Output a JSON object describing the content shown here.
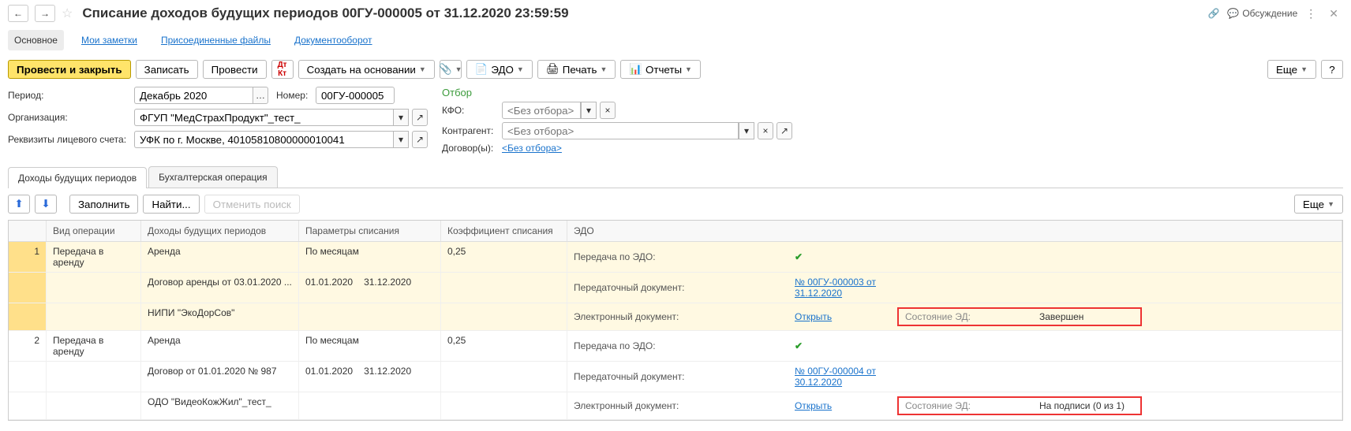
{
  "header": {
    "title": "Списание доходов будущих периодов 00ГУ-000005 от 31.12.2020 23:59:59",
    "discuss": "Обсуждение"
  },
  "navtabs": {
    "main": "Основное",
    "notes": "Мои заметки",
    "files": "Присоединенные файлы",
    "docflow": "Документооборот"
  },
  "toolbar": {
    "post_close": "Провести и закрыть",
    "save": "Записать",
    "post": "Провести",
    "create_based": "Создать на основании",
    "edo": "ЭДО",
    "print": "Печать",
    "reports": "Отчеты",
    "more": "Еще"
  },
  "form": {
    "period_label": "Период:",
    "period_value": "Декабрь 2020",
    "number_label": "Номер:",
    "number_value": "00ГУ-000005",
    "org_label": "Организация:",
    "org_value": "ФГУП \"МедСтрахПродукт\"_тест_",
    "acct_label": "Реквизиты лицевого счета:",
    "acct_value": "УФК по г. Москве, 40105810800000010041"
  },
  "filter": {
    "title": "Отбор",
    "kfo_label": "КФО:",
    "counterparty_label": "Контрагент:",
    "contracts_label": "Договор(ы):",
    "placeholder": "<Без отбора>",
    "contracts_value": "<Без отбора>"
  },
  "doctabs": {
    "incomes": "Доходы будущих периодов",
    "accounting": "Бухгалтерская операция"
  },
  "table_toolbar": {
    "fill": "Заполнить",
    "find": "Найти...",
    "cancel_find": "Отменить поиск",
    "more": "Еще"
  },
  "thead": {
    "op": "Вид операции",
    "inc": "Доходы будущих периодов",
    "par": "Параметры списания",
    "coef": "Коэффициент списания",
    "edo": "ЭДО"
  },
  "rows": [
    {
      "n": "1",
      "op": "Передача в аренду",
      "inc_lines": [
        "Аренда",
        "Договор аренды от 03.01.2020 ...",
        "НИПИ \"ЭкоДорСов\""
      ],
      "par_mode": "По месяцам",
      "par_from": "01.01.2020",
      "par_to": "31.12.2020",
      "coef": "0,25",
      "edo_transfer_label": "Передача по ЭДО:",
      "edo_checked": true,
      "transfer_doc_label": "Передаточный документ:",
      "transfer_doc_link": "№ 00ГУ-000003 от 31.12.2020",
      "e_doc_label": "Электронный документ:",
      "e_doc_action": "Открыть",
      "state_label": "Состояние ЭД:",
      "state_value": "Завершен"
    },
    {
      "n": "2",
      "op": "Передача в аренду",
      "inc_lines": [
        "Аренда",
        "Договор от 01.01.2020 № 987",
        "ОДО \"ВидеоКожЖил\"_тест_"
      ],
      "par_mode": "По месяцам",
      "par_from": "01.01.2020",
      "par_to": "31.12.2020",
      "coef": "0,25",
      "edo_transfer_label": "Передача по ЭДО:",
      "edo_checked": true,
      "transfer_doc_label": "Передаточный документ:",
      "transfer_doc_link": "№ 00ГУ-000004 от 30.12.2020",
      "e_doc_label": "Электронный документ:",
      "e_doc_action": "Открыть",
      "state_label": "Состояние ЭД:",
      "state_value": "На подписи (0 из 1)"
    }
  ]
}
